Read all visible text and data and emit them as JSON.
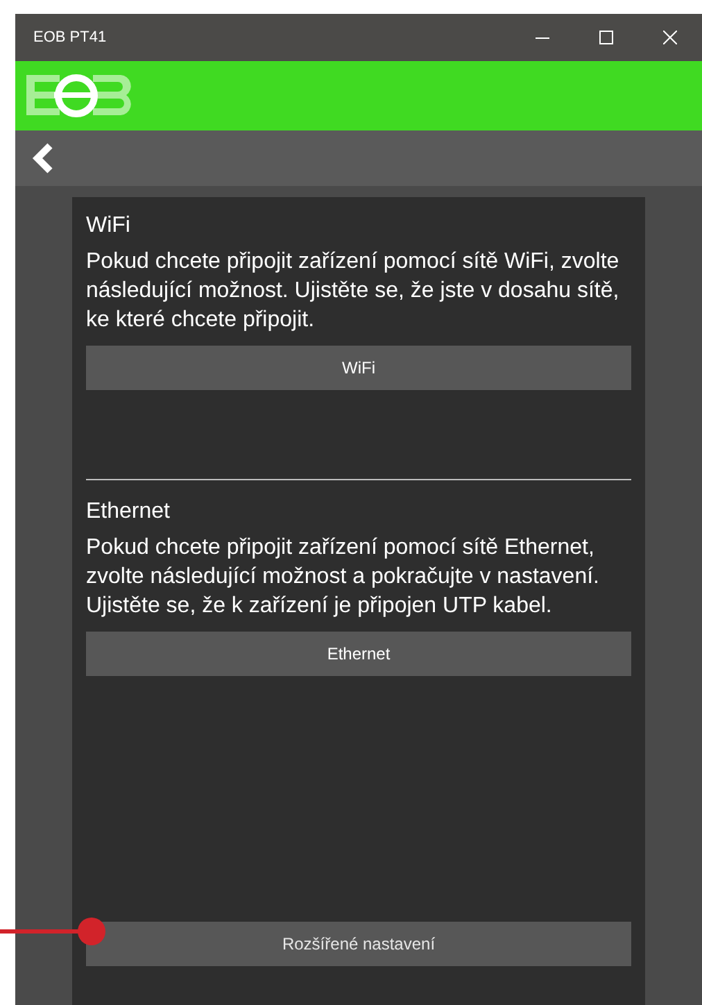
{
  "window": {
    "title": "EOB PT41"
  },
  "sections": [
    {
      "title": "WiFi",
      "description": "Pokud chcete připojit zařízení pomocí sítě WiFi, zvolte následující možnost. Ujistěte se, že jste v dosahu sítě, ke které chcete připojit.",
      "button": "WiFi"
    },
    {
      "title": "Ethernet",
      "description": "Pokud chcete připojit zařízení pomocí sítě Ethernet, zvolte následující možnost a pokračujte v nastavení. Ujistěte se, že k zařízení je připojen UTP kabel.",
      "button": "Ethernet"
    }
  ],
  "advanced_button": "Rozšířené nastavení"
}
